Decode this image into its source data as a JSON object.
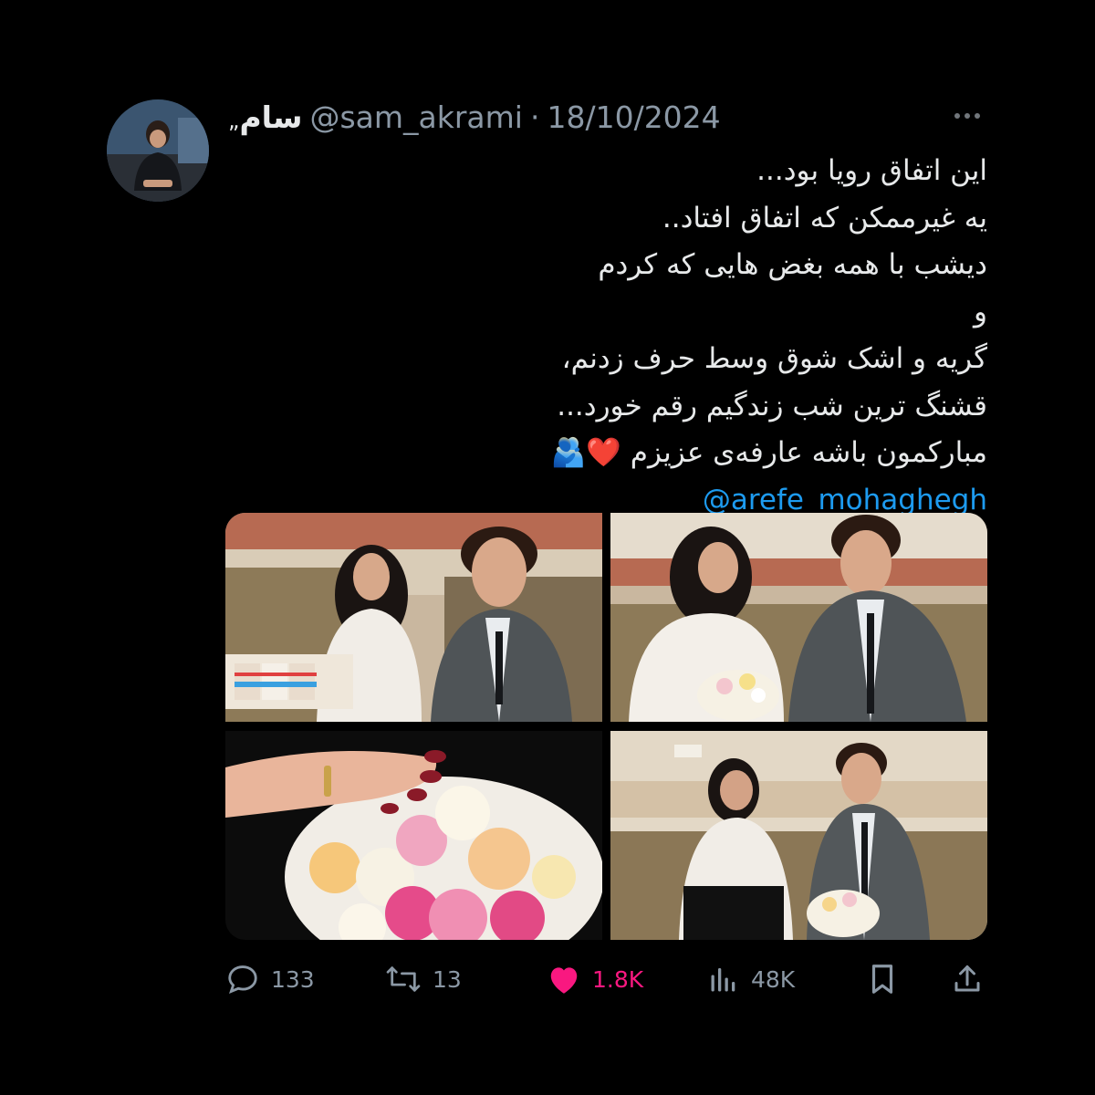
{
  "user": {
    "display_name": "سام",
    "name_suffix": "„",
    "handle": "@sam_akrami",
    "separator": "·",
    "date": "18/10/2024"
  },
  "tweet": {
    "lines": [
      "این اتفاق رویا بود...",
      "یه غیرممکن که اتفاق افتاد..",
      "دیشب با همه بغض هایی که کردم",
      "و",
      "گریه و اشک شوق وسط حرف زدنم،",
      "قشنگ ترین شب زندگیم رقم خورد...",
      "مبارکمون باشه عارفه‌ی عزیزم ❤️🫂"
    ],
    "mention": "@arefe_mohaghegh"
  },
  "media": {
    "photos": [
      "couple-with-sweets-photo",
      "couple-with-bouquet-photo",
      "ring-hand-on-roses-photo",
      "couple-laughing-photo"
    ]
  },
  "actions": {
    "replies": "133",
    "reposts": "13",
    "likes": "1.8K",
    "views": "48K"
  },
  "colors": {
    "background": "#000000",
    "text": "#e7e9ea",
    "secondary": "#8b98a5",
    "link": "#1d9bf0",
    "like": "#f91880"
  },
  "icons": [
    "more-icon",
    "reply-icon",
    "retweet-icon",
    "heart-icon",
    "views-icon",
    "bookmark-icon",
    "share-icon"
  ]
}
